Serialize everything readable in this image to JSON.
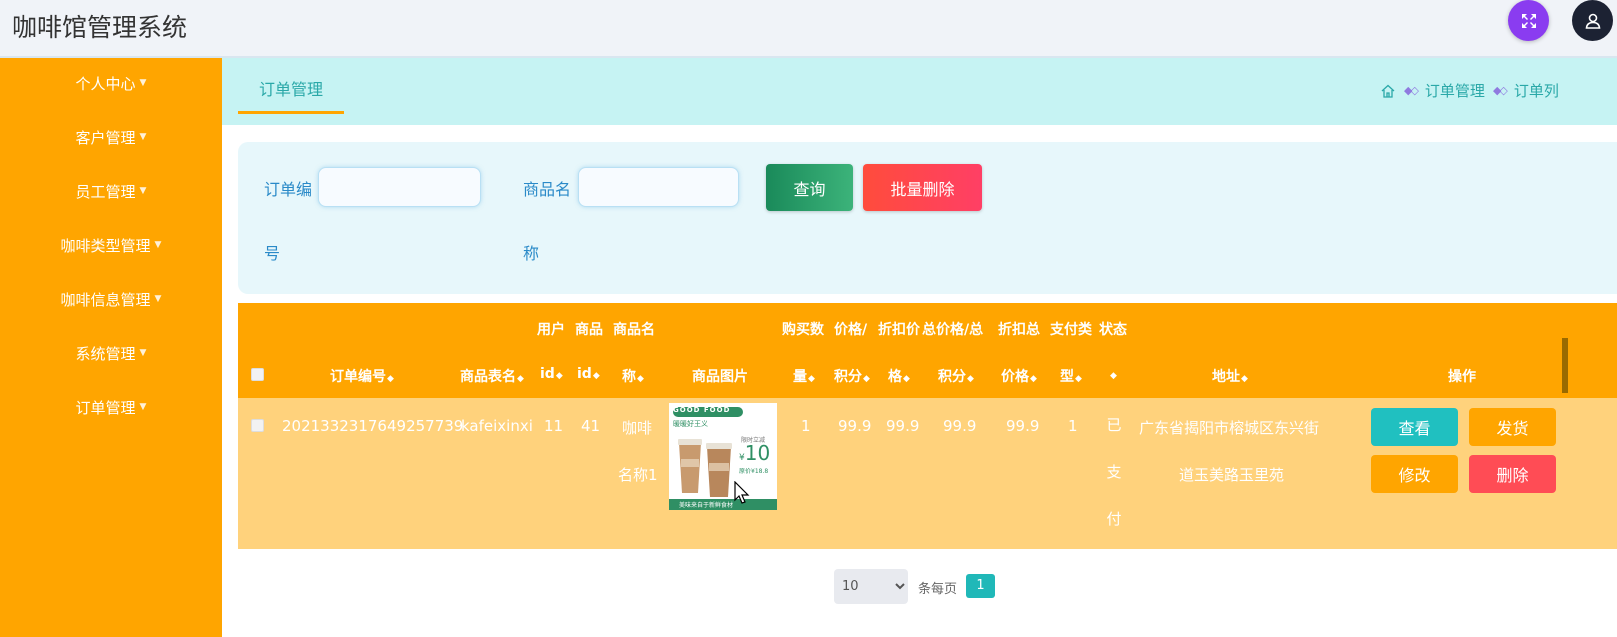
{
  "header": {
    "app_title": "咖啡馆管理系统",
    "fullscreen_icon": "expand-icon",
    "user_icon": "user-icon"
  },
  "sidebar": {
    "items": [
      {
        "label": "个人中心"
      },
      {
        "label": "客户管理"
      },
      {
        "label": "员工管理"
      },
      {
        "label": "咖啡类型管理"
      },
      {
        "label": "咖啡信息管理"
      },
      {
        "label": "系统管理"
      },
      {
        "label": "订单管理"
      }
    ]
  },
  "tabs": {
    "active": "订单管理"
  },
  "breadcrumb": {
    "items": [
      "订单管理",
      "订单列"
    ]
  },
  "search": {
    "order_label_1": "订单编",
    "order_label_2": "号",
    "product_label_1": "商品名",
    "product_label_2": "称",
    "order_value": "",
    "product_value": "",
    "query_button": "查询",
    "batch_delete_button": "批量删除"
  },
  "table": {
    "headers": {
      "order_no": "订单编号",
      "table_name": "商品表名",
      "user_id_1": "用户",
      "user_id_2": "id",
      "product_id_1": "商品",
      "product_id_2": "id",
      "product_name_1": "商品名",
      "product_name_2": "称",
      "product_image": "商品图片",
      "qty_1": "购买数",
      "qty_2": "量",
      "price_1": "价格/",
      "price_2": "积分",
      "discount_price_1": "折扣价",
      "discount_price_2": "格",
      "total_1": "总价格/总",
      "total_2": "积分",
      "discount_total_1": "折扣总",
      "discount_total_2": "价格",
      "pay_type_1": "支付类",
      "pay_type_2": "型",
      "status": "状态",
      "address": "地址",
      "actions": "操作"
    },
    "rows": [
      {
        "order_no": "2021332317649257739",
        "table_name": "kafeixinxi",
        "user_id": "11",
        "product_id": "41",
        "product_name_1": "咖啡",
        "product_name_2": "名称1",
        "qty": "1",
        "price": "99.9",
        "discount_price": "99.9",
        "total": "99.9",
        "discount_total": "99.9",
        "pay_type": "1",
        "status_chars": [
          "已",
          "支",
          "付"
        ],
        "address_1": "广东省揭阳市榕城区东兴街",
        "address_2": "道玉美路玉里苑",
        "image_text_top": "GOOD FOOD",
        "image_text_sub": "暖暖好王义",
        "image_price": "10",
        "image_caption_1": "限时立减",
        "image_caption_2": "原价¥18.8",
        "image_footer": "美味来自于新鲜食材"
      }
    ],
    "actions": {
      "view": "查看",
      "ship": "发货",
      "edit": "修改",
      "delete": "删除"
    }
  },
  "pagination": {
    "page_size": "10",
    "per_page_label": "条每页",
    "current_page": "1"
  },
  "colors": {
    "sidebar": "#ffa500",
    "tabstrip": "#c6f3f3",
    "table_header": "#ffa500",
    "table_row": "#ffd27c",
    "accent_teal": "#20c0c0"
  }
}
